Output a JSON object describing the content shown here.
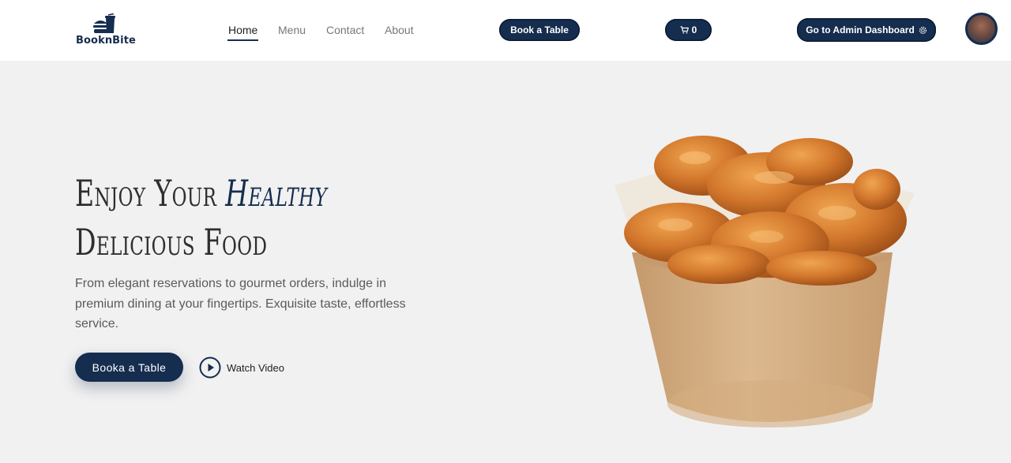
{
  "brand": {
    "name": "BooknBite",
    "icon": "burger-drink-icon"
  },
  "nav": {
    "items": [
      "Home",
      "Menu",
      "Contact",
      "About"
    ],
    "active": "Home"
  },
  "header_actions": {
    "book_table": "Book a Table",
    "cart_count": "0",
    "cart_icon": "cart-icon",
    "admin_label": "Go to Admin Dashboard",
    "admin_icon": "gear-icon"
  },
  "hero": {
    "title_line1_part1": "Enjoy Your",
    "title_line1_accent": "Healthy",
    "title_line2": "Delicious Food",
    "description": "From elegant reservations to gourmet orders, indulge in premium dining at your fingertips. Exquisite taste, effortless service.",
    "cta_label": "Booka a Table",
    "watch_label": "Watch Video"
  },
  "colors": {
    "primary": "#152d4f",
    "background": "#f1f1f1",
    "header_bg": "#ffffff"
  }
}
